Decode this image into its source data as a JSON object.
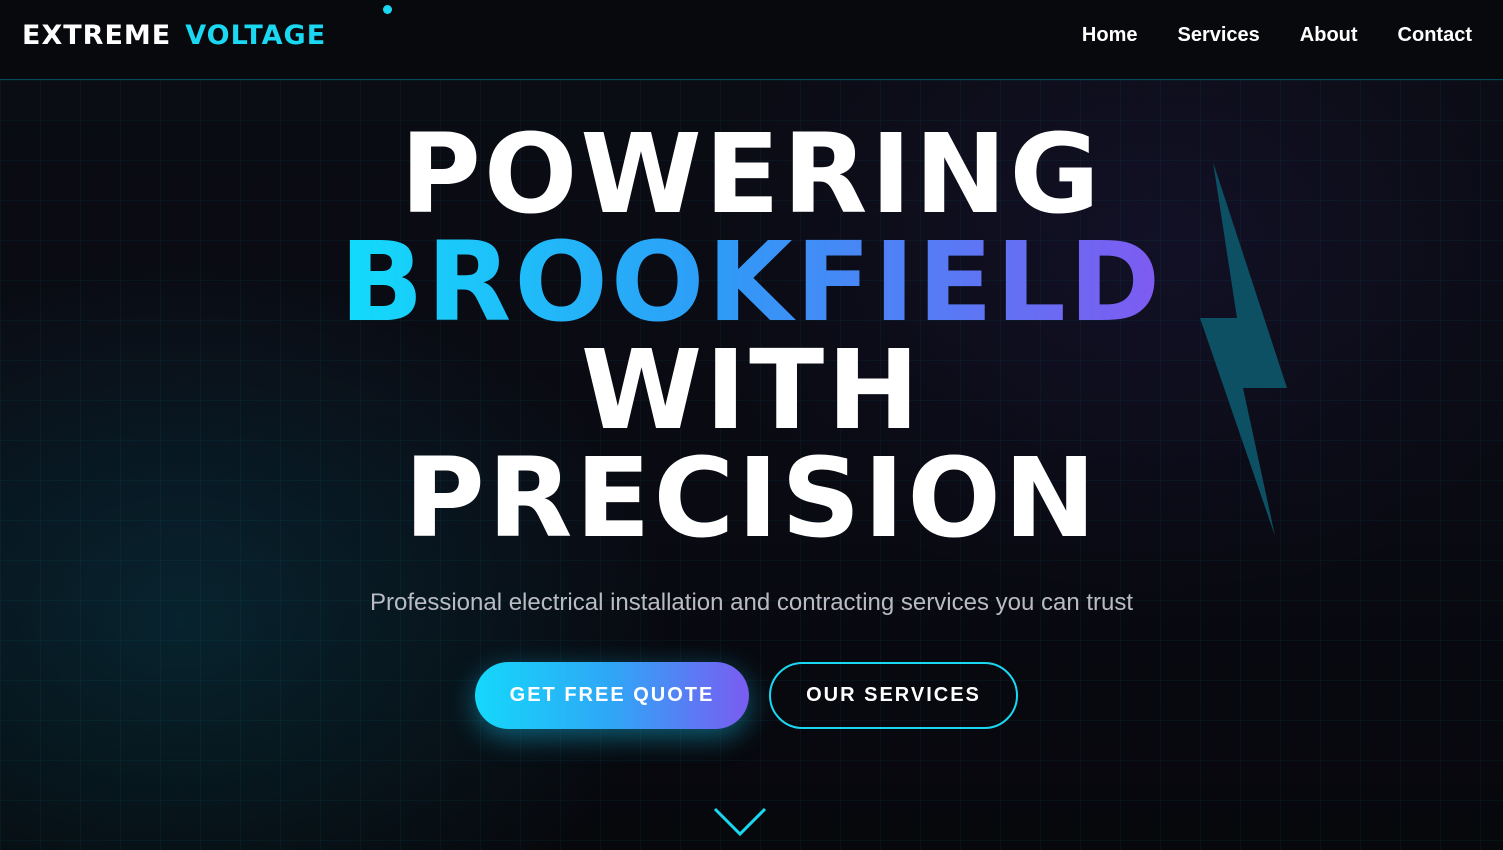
{
  "brand": {
    "part1": "EXTREME",
    "part2": "VOLTAGE",
    "accent_color": "#1ad8f2"
  },
  "nav": {
    "items": [
      {
        "label": "Home"
      },
      {
        "label": "Services"
      },
      {
        "label": "About"
      },
      {
        "label": "Contact"
      }
    ]
  },
  "hero": {
    "line1": "POWERING",
    "line2": "BROOKFIELD",
    "line3": "WITH",
    "line4": "PRECISION",
    "subtitle": "Professional electrical installation and contracting services you can trust",
    "primary_cta": "GET FREE QUOTE",
    "secondary_cta": "OUR SERVICES",
    "gradient": [
      "#12dcfb",
      "#2e9cf7",
      "#5a78f5",
      "#7f5af1"
    ],
    "decor_icon": "lightning-bolt-icon",
    "scroll_icon": "chevron-down-icon"
  }
}
